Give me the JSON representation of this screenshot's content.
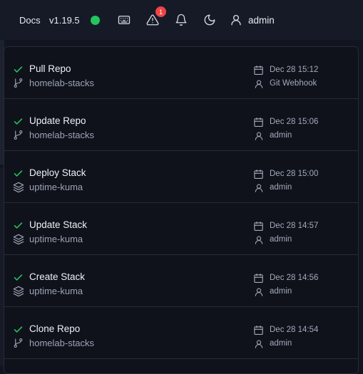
{
  "header": {
    "docs_label": "Docs",
    "version": "v1.19.5",
    "status_color": "#22c55e",
    "alerts_count": "1",
    "user_name": "admin"
  },
  "updates": [
    {
      "title": "Pull Repo",
      "target": "homelab-stacks",
      "target_icon": "git-branch-icon",
      "date": "Dec 28 15:12",
      "operator": "Git Webhook",
      "status": "success"
    },
    {
      "title": "Update Repo",
      "target": "homelab-stacks",
      "target_icon": "git-branch-icon",
      "date": "Dec 28 15:06",
      "operator": "admin",
      "status": "success"
    },
    {
      "title": "Deploy Stack",
      "target": "uptime-kuma",
      "target_icon": "layers-icon",
      "date": "Dec 28 15:00",
      "operator": "admin",
      "status": "success"
    },
    {
      "title": "Update Stack",
      "target": "uptime-kuma",
      "target_icon": "layers-icon",
      "date": "Dec 28 14:57",
      "operator": "admin",
      "status": "success"
    },
    {
      "title": "Create Stack",
      "target": "uptime-kuma",
      "target_icon": "layers-icon",
      "date": "Dec 28 14:56",
      "operator": "admin",
      "status": "success"
    },
    {
      "title": "Clone Repo",
      "target": "homelab-stacks",
      "target_icon": "git-branch-icon",
      "date": "Dec 28 14:54",
      "operator": "admin",
      "status": "success"
    }
  ],
  "colors": {
    "success": "#22c55e",
    "alert_badge": "#ef4444"
  }
}
